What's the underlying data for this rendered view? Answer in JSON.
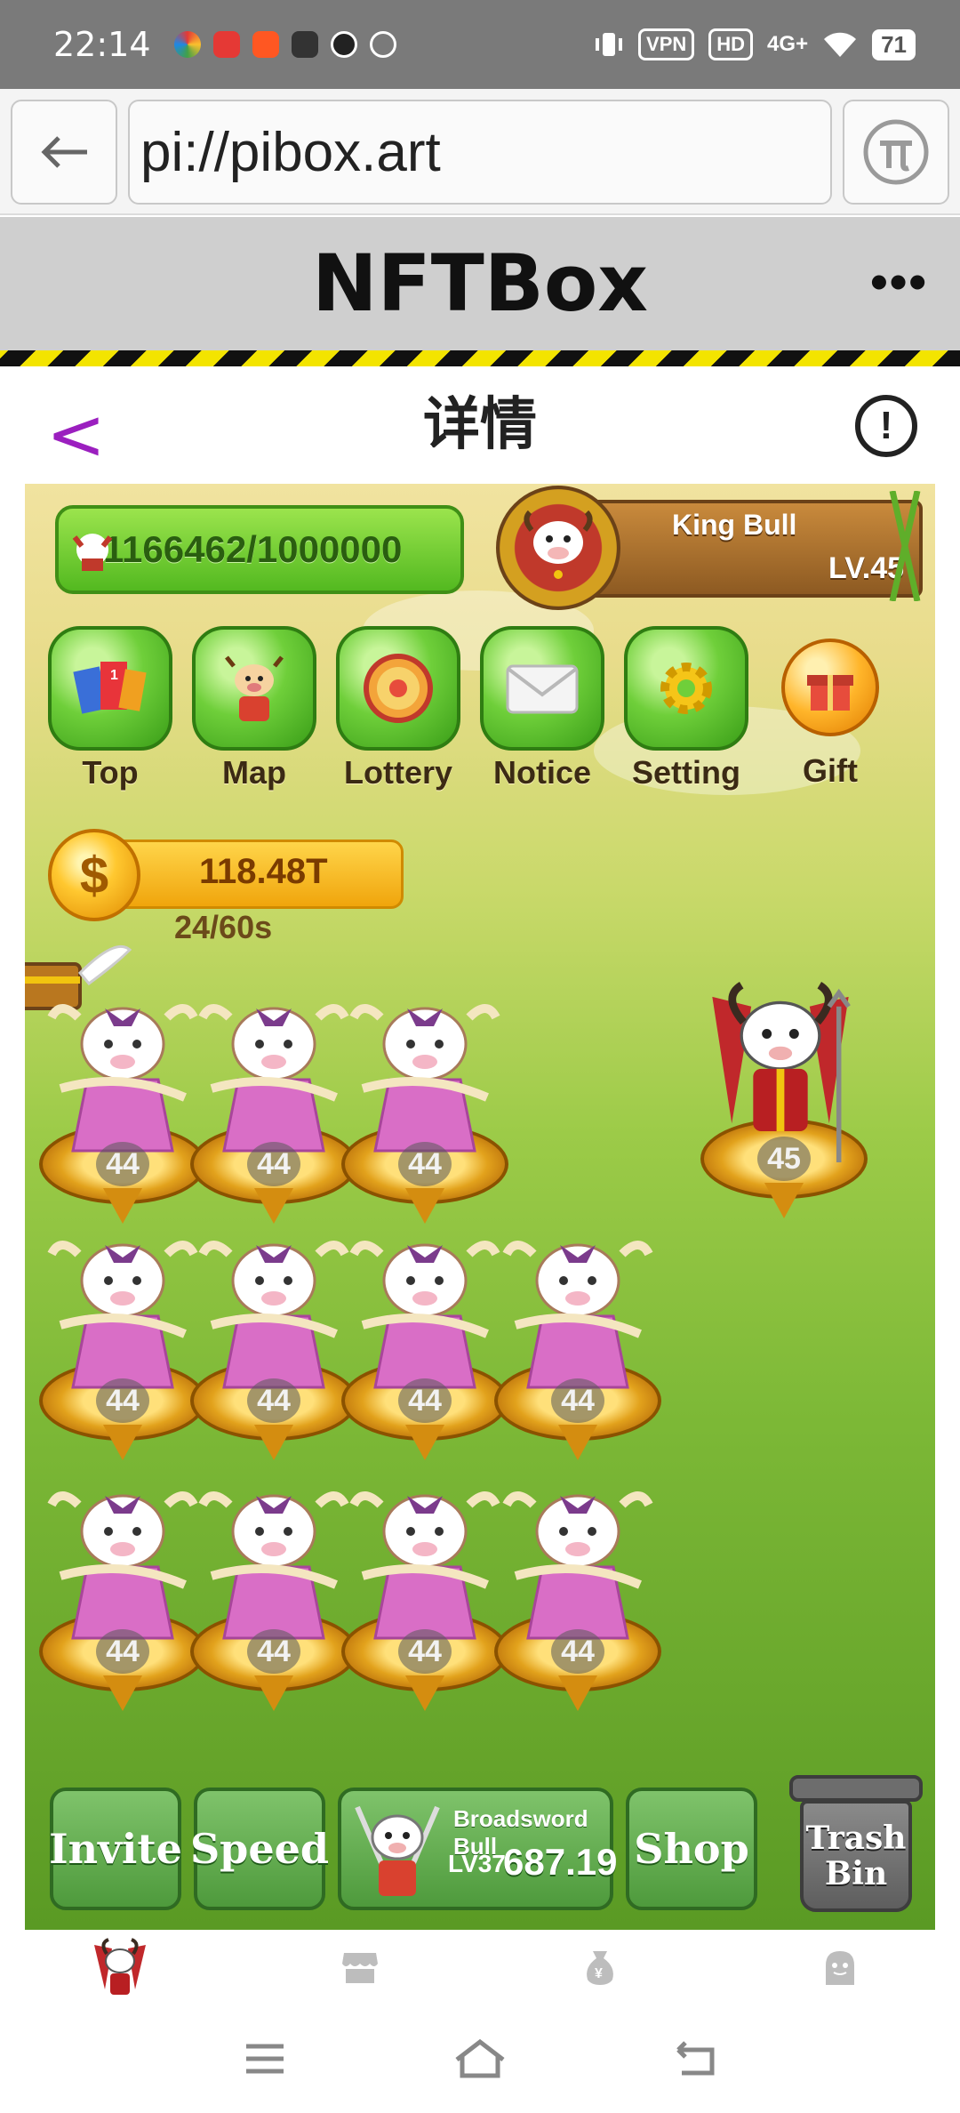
{
  "status_bar": {
    "time": "22:14",
    "vpn": "VPN",
    "hd": "HD",
    "network": "4G+",
    "battery": "71"
  },
  "browser": {
    "url": "pi://pibox.art",
    "back_icon": "arrow-left-icon",
    "pi_icon": "pi-logo-icon"
  },
  "app": {
    "title": "NFTBox",
    "more": "•••"
  },
  "page": {
    "title": "详情",
    "back": "<",
    "info": "!"
  },
  "game": {
    "progress": "1166462/1000000",
    "player_name": "King Bull",
    "player_level": "LV.45",
    "menu": [
      {
        "label": "Top",
        "icon": "trophy-book-icon"
      },
      {
        "label": "Map",
        "icon": "bull-map-icon"
      },
      {
        "label": "Lottery",
        "icon": "wheel-icon"
      },
      {
        "label": "Notice",
        "icon": "envelope-icon"
      },
      {
        "label": "Setting",
        "icon": "gear-icon"
      },
      {
        "label": "Gift",
        "icon": "gift-icon"
      }
    ],
    "coins": "118.48T",
    "coin_symbol": "$",
    "timer": "24/60s",
    "grid_levels": [
      [
        "44",
        "44",
        "44",
        "45"
      ],
      [
        "44",
        "44",
        "44",
        "44"
      ],
      [
        "44",
        "44",
        "44",
        "44"
      ]
    ],
    "bottom": {
      "invite": "Invite",
      "speed": "Speed",
      "merge_name": "Broadsword Bull",
      "merge_level": "LV37",
      "merge_value": "687.19",
      "shop": "Shop",
      "trash_line1": "Trash",
      "trash_line2": "Bin"
    }
  },
  "tabs": [
    {
      "icon": "bull-avatar-icon",
      "active": true
    },
    {
      "icon": "store-icon",
      "active": false
    },
    {
      "icon": "money-bag-icon",
      "active": false
    },
    {
      "icon": "ghost-profile-icon",
      "active": false
    }
  ],
  "colors": {
    "accent_purple": "#9b1fbf",
    "game_green": "#6fcf3a",
    "coin_gold": "#ffc830"
  }
}
